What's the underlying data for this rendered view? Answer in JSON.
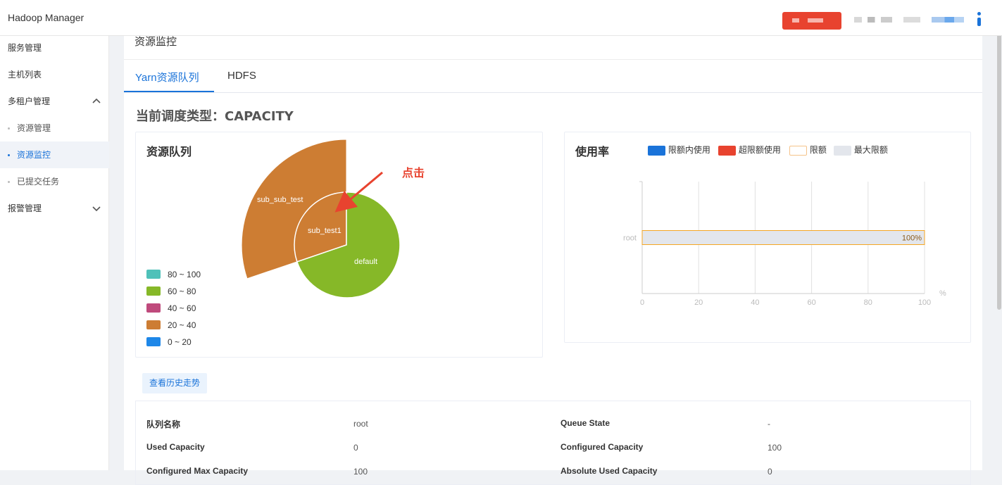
{
  "app": {
    "title": "Hadoop Manager"
  },
  "sidebar": {
    "items": [
      {
        "label": "服务管理"
      },
      {
        "label": "主机列表"
      },
      {
        "label": "多租户管理"
      },
      {
        "label": "资源管理"
      },
      {
        "label": "资源监控"
      },
      {
        "label": "已提交任务"
      },
      {
        "label": "报警管理"
      }
    ]
  },
  "page": {
    "title": "资源监控"
  },
  "tabs": [
    {
      "label": "Yarn资源队列"
    },
    {
      "label": "HDFS"
    }
  ],
  "scheduler": {
    "text": "当前调度类型：CAPACITY"
  },
  "queue_card": {
    "title": "资源队列",
    "annotation": "点击",
    "legend": [
      {
        "label": "80 ~ 100",
        "color": "#4fc1b9"
      },
      {
        "label": "60 ~ 80",
        "color": "#86b828"
      },
      {
        "label": "40 ~ 60",
        "color": "#bf4a7c"
      },
      {
        "label": "20 ~ 40",
        "color": "#cd7d33"
      },
      {
        "label": "0 ~ 20",
        "color": "#1e87e8"
      }
    ],
    "segments": [
      {
        "name": "default",
        "color": "#86b828"
      },
      {
        "name": "sub_test1",
        "color": "#cd7d33"
      },
      {
        "name": "sub_sub_test",
        "color": "#cd7d33"
      }
    ]
  },
  "usage_card": {
    "title": "使用率",
    "legend": [
      {
        "label": "限额内使用",
        "color": "#1a73d9"
      },
      {
        "label": "超限额使用",
        "color": "#e8432f"
      },
      {
        "label": "限额",
        "color": "#f5c38a"
      },
      {
        "label": "最大限额",
        "color": "#e3e6ec"
      }
    ]
  },
  "chart_data": {
    "type": "bar",
    "orientation": "horizontal",
    "categories": [
      "root"
    ],
    "series": [
      {
        "name": "最大限额",
        "values": [
          100
        ]
      }
    ],
    "data_labels": [
      "100%"
    ],
    "xlim": [
      0,
      100
    ],
    "xticks": [
      "0",
      "20",
      "40",
      "60",
      "80",
      "100"
    ],
    "xunit": "%",
    "grid": true,
    "legend_position": "top"
  },
  "actions": {
    "history_label": "查看历史走势"
  },
  "details": [
    {
      "label": "队列名称",
      "value": "root"
    },
    {
      "label": "Queue State",
      "value": "-"
    },
    {
      "label": "Used Capacity",
      "value": "0"
    },
    {
      "label": "Configured Capacity",
      "value": "100"
    },
    {
      "label": "Configured Max Capacity",
      "value": "100"
    },
    {
      "label": "Absolute Used Capacity",
      "value": "0"
    }
  ]
}
